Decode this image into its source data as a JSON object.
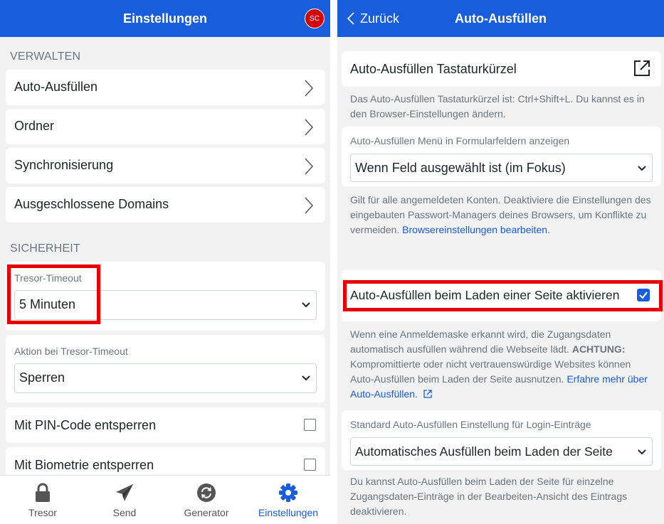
{
  "left": {
    "header": {
      "title": "Einstellungen",
      "avatar_initials": "SC"
    },
    "manage_label": "VERWALTEN",
    "manage_items": [
      {
        "label": "Auto-Ausfüllen"
      },
      {
        "label": "Ordner"
      },
      {
        "label": "Synchronisierung"
      },
      {
        "label": "Ausgeschlossene Domains"
      }
    ],
    "security_label": "SICHERHEIT",
    "vault_timeout": {
      "label": "Tresor-Timeout",
      "value": "5 Minuten"
    },
    "timeout_action": {
      "label": "Aktion bei Tresor-Timeout",
      "value": "Sperren"
    },
    "pin_unlock": {
      "label": "Mit PIN-Code entsperren",
      "checked": false
    },
    "biometric_unlock": {
      "label": "Mit Biometrie entsperren",
      "checked": false
    },
    "tabs": [
      {
        "label": "Tresor",
        "icon": "lock-icon"
      },
      {
        "label": "Send",
        "icon": "send-icon"
      },
      {
        "label": "Generator",
        "icon": "generator-icon"
      },
      {
        "label": "Einstellungen",
        "icon": "gear-icon",
        "active": true
      }
    ]
  },
  "right": {
    "header": {
      "title": "Auto-Ausfüllen",
      "back_label": "Zurück"
    },
    "shortcut_title": "Auto-Ausfüllen Tastaturkürzel",
    "shortcut_help": "Das Auto-Ausfüllen Tastaturkürzel ist: Ctrl+Shift+L. Du kannst es in den Browser-Einstellungen ändern.",
    "menu_label": "Auto-Ausfüllen Menü in Formularfeldern anzeigen",
    "menu_value": "Wenn Feld ausgewählt ist (im Fokus)",
    "menu_help": "Gilt für alle angemeldeten Konten. Deaktiviere die Einstellungen des eingebauten Passwort-Managers deines Browsers, um Konflikte zu vermeiden.",
    "menu_help_link": "Browsereinstellungen bearbeiten.",
    "autofill_on_load_label": "Auto-Ausfüllen beim Laden einer Seite aktivieren",
    "autofill_on_load_checked": true,
    "onload_help_1": "Wenn eine Anmeldemaske erkannt wird, die Zugangsdaten automatisch ausfüllen während die Webseite lädt.",
    "onload_help_warning": "ACHTUNG:",
    "onload_help_2": "Kompromittierte oder nicht vertrauenswürdige Websites können Auto-Ausfüllen beim Laden der Seite ausnutzen.",
    "onload_help_link": "Erfahre mehr über Auto-Ausfüllen.",
    "default_label": "Standard Auto-Ausfüllen Einstellung für Login-Einträge",
    "default_value": "Automatisches Ausfüllen beim Laden der Seite",
    "default_help": "Du kannst Auto-Ausfüllen beim Laden der Seite für einzelne Zugangsdaten-Einträge in der Bearbeiten-Ansicht des Eintrags deaktivieren."
  },
  "colors": {
    "primary": "#175ddc",
    "highlight": "#e60000",
    "avatar": "#d3020d"
  }
}
